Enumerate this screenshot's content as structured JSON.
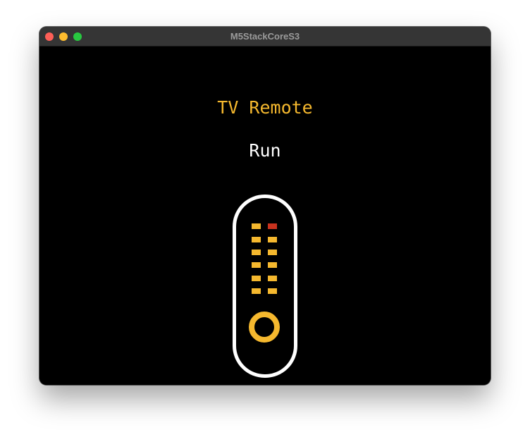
{
  "window": {
    "title": "M5StackCoreS3"
  },
  "app": {
    "title": "TV Remote",
    "status": "Run"
  },
  "icon": {
    "name": "tv-remote-icon",
    "colors": {
      "outline": "#ffffff",
      "button": "#f5b82e",
      "active_button": "#c8321e",
      "dpad": "#f5b82e"
    }
  },
  "colors": {
    "title": "#f5b82e",
    "status": "#ffffff",
    "background": "#000000"
  }
}
